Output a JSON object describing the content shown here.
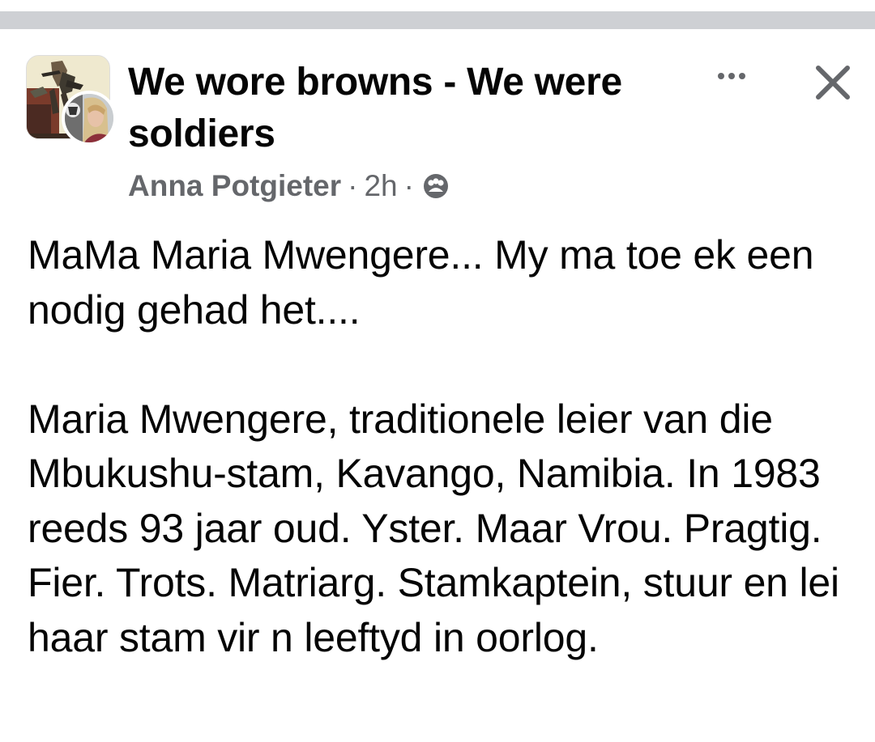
{
  "post": {
    "group_name": "We wore browns - We were soldiers",
    "author": "Anna Potgieter",
    "separator": "·",
    "time": "2h",
    "privacy_icon": "group-members-icon",
    "more_icon": "more-horizontal-icon",
    "close_icon": "close-icon",
    "paragraphs": [
      "MaMa Maria Mwengere... My ma toe ek een nodig gehad het....",
      "Maria Mwengere, traditionele leier van die Mbukushu-stam, Kavango, Namibia. In 1983 reeds 93 jaar oud. Yster. Maar Vrou. Pragtig. Fier. Trots. Matriarg. Stamkaptein, stuur en lei haar stam vir n leeftyd in oorlog."
    ]
  },
  "colors": {
    "divider": "#ced0d4",
    "primary_text": "#050505",
    "secondary_text": "#65676b",
    "icon": "#65676b"
  }
}
